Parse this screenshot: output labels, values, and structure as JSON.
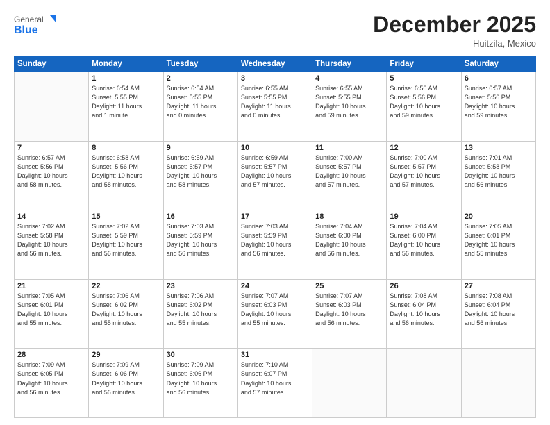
{
  "header": {
    "logo_general": "General",
    "logo_blue": "Blue",
    "month": "December 2025",
    "location": "Huitzila, Mexico"
  },
  "weekdays": [
    "Sunday",
    "Monday",
    "Tuesday",
    "Wednesday",
    "Thursday",
    "Friday",
    "Saturday"
  ],
  "weeks": [
    [
      {
        "day": "",
        "info": ""
      },
      {
        "day": "1",
        "info": "Sunrise: 6:54 AM\nSunset: 5:55 PM\nDaylight: 11 hours\nand 1 minute."
      },
      {
        "day": "2",
        "info": "Sunrise: 6:54 AM\nSunset: 5:55 PM\nDaylight: 11 hours\nand 0 minutes."
      },
      {
        "day": "3",
        "info": "Sunrise: 6:55 AM\nSunset: 5:55 PM\nDaylight: 11 hours\nand 0 minutes."
      },
      {
        "day": "4",
        "info": "Sunrise: 6:55 AM\nSunset: 5:55 PM\nDaylight: 10 hours\nand 59 minutes."
      },
      {
        "day": "5",
        "info": "Sunrise: 6:56 AM\nSunset: 5:56 PM\nDaylight: 10 hours\nand 59 minutes."
      },
      {
        "day": "6",
        "info": "Sunrise: 6:57 AM\nSunset: 5:56 PM\nDaylight: 10 hours\nand 59 minutes."
      }
    ],
    [
      {
        "day": "7",
        "info": "Sunrise: 6:57 AM\nSunset: 5:56 PM\nDaylight: 10 hours\nand 58 minutes."
      },
      {
        "day": "8",
        "info": "Sunrise: 6:58 AM\nSunset: 5:56 PM\nDaylight: 10 hours\nand 58 minutes."
      },
      {
        "day": "9",
        "info": "Sunrise: 6:59 AM\nSunset: 5:57 PM\nDaylight: 10 hours\nand 58 minutes."
      },
      {
        "day": "10",
        "info": "Sunrise: 6:59 AM\nSunset: 5:57 PM\nDaylight: 10 hours\nand 57 minutes."
      },
      {
        "day": "11",
        "info": "Sunrise: 7:00 AM\nSunset: 5:57 PM\nDaylight: 10 hours\nand 57 minutes."
      },
      {
        "day": "12",
        "info": "Sunrise: 7:00 AM\nSunset: 5:57 PM\nDaylight: 10 hours\nand 57 minutes."
      },
      {
        "day": "13",
        "info": "Sunrise: 7:01 AM\nSunset: 5:58 PM\nDaylight: 10 hours\nand 56 minutes."
      }
    ],
    [
      {
        "day": "14",
        "info": "Sunrise: 7:02 AM\nSunset: 5:58 PM\nDaylight: 10 hours\nand 56 minutes."
      },
      {
        "day": "15",
        "info": "Sunrise: 7:02 AM\nSunset: 5:59 PM\nDaylight: 10 hours\nand 56 minutes."
      },
      {
        "day": "16",
        "info": "Sunrise: 7:03 AM\nSunset: 5:59 PM\nDaylight: 10 hours\nand 56 minutes."
      },
      {
        "day": "17",
        "info": "Sunrise: 7:03 AM\nSunset: 5:59 PM\nDaylight: 10 hours\nand 56 minutes."
      },
      {
        "day": "18",
        "info": "Sunrise: 7:04 AM\nSunset: 6:00 PM\nDaylight: 10 hours\nand 56 minutes."
      },
      {
        "day": "19",
        "info": "Sunrise: 7:04 AM\nSunset: 6:00 PM\nDaylight: 10 hours\nand 56 minutes."
      },
      {
        "day": "20",
        "info": "Sunrise: 7:05 AM\nSunset: 6:01 PM\nDaylight: 10 hours\nand 55 minutes."
      }
    ],
    [
      {
        "day": "21",
        "info": "Sunrise: 7:05 AM\nSunset: 6:01 PM\nDaylight: 10 hours\nand 55 minutes."
      },
      {
        "day": "22",
        "info": "Sunrise: 7:06 AM\nSunset: 6:02 PM\nDaylight: 10 hours\nand 55 minutes."
      },
      {
        "day": "23",
        "info": "Sunrise: 7:06 AM\nSunset: 6:02 PM\nDaylight: 10 hours\nand 55 minutes."
      },
      {
        "day": "24",
        "info": "Sunrise: 7:07 AM\nSunset: 6:03 PM\nDaylight: 10 hours\nand 55 minutes."
      },
      {
        "day": "25",
        "info": "Sunrise: 7:07 AM\nSunset: 6:03 PM\nDaylight: 10 hours\nand 56 minutes."
      },
      {
        "day": "26",
        "info": "Sunrise: 7:08 AM\nSunset: 6:04 PM\nDaylight: 10 hours\nand 56 minutes."
      },
      {
        "day": "27",
        "info": "Sunrise: 7:08 AM\nSunset: 6:04 PM\nDaylight: 10 hours\nand 56 minutes."
      }
    ],
    [
      {
        "day": "28",
        "info": "Sunrise: 7:09 AM\nSunset: 6:05 PM\nDaylight: 10 hours\nand 56 minutes."
      },
      {
        "day": "29",
        "info": "Sunrise: 7:09 AM\nSunset: 6:06 PM\nDaylight: 10 hours\nand 56 minutes."
      },
      {
        "day": "30",
        "info": "Sunrise: 7:09 AM\nSunset: 6:06 PM\nDaylight: 10 hours\nand 56 minutes."
      },
      {
        "day": "31",
        "info": "Sunrise: 7:10 AM\nSunset: 6:07 PM\nDaylight: 10 hours\nand 57 minutes."
      },
      {
        "day": "",
        "info": ""
      },
      {
        "day": "",
        "info": ""
      },
      {
        "day": "",
        "info": ""
      }
    ]
  ]
}
